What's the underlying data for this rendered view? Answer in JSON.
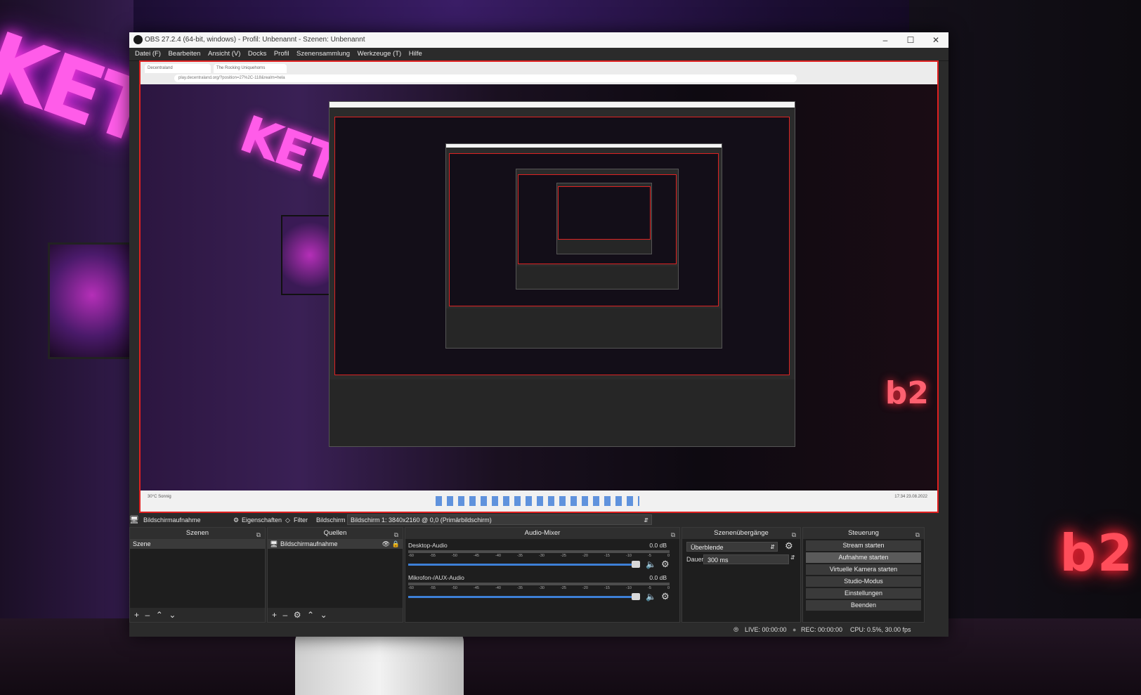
{
  "window": {
    "title": "OBS 27.2.4 (64-bit, windows) - Profil: Unbenannt - Szenen: Unbenannt"
  },
  "menu": [
    "Datei (F)",
    "Bearbeiten",
    "Ansicht (V)",
    "Docks",
    "Profil",
    "Szenensammlung",
    "Werkzeuge (T)",
    "Hilfe"
  ],
  "browser": {
    "tab1": "Decentraland",
    "tab2": "The Rocking Uniquehorns",
    "url": "play.decentraland.org/?position=27%2C-118&realm=hela"
  },
  "taskbar": {
    "weather": "30°C Sonnig",
    "clock": "17:34 23.08.2022"
  },
  "source_toolbar": {
    "source_name": "Bildschirmaufnahme",
    "properties": "Eigenschaften",
    "filter": "Filter",
    "display_label": "Bildschirm",
    "display_value": "Bildschirm 1: 3840x2160 @ 0,0 (Primärbildschirm)"
  },
  "scenes": {
    "title": "Szenen",
    "items": [
      "Szene"
    ]
  },
  "sources": {
    "title": "Quellen",
    "items": [
      "Bildschirmaufnahme"
    ]
  },
  "mixer": {
    "title": "Audio-Mixer",
    "channels": [
      {
        "name": "Desktop-Audio",
        "db": "0.0 dB"
      },
      {
        "name": "Mikrofon-/AUX-Audio",
        "db": "0.0 dB"
      }
    ],
    "ticks": [
      "-60",
      "-55",
      "-50",
      "-45",
      "-40",
      "-35",
      "-30",
      "-25",
      "-20",
      "-15",
      "-10",
      "-5",
      "0"
    ]
  },
  "transitions": {
    "title": "Szenenübergänge",
    "selected": "Überblende",
    "duration_label": "Dauer",
    "duration_value": "300 ms"
  },
  "controls": {
    "title": "Steuerung",
    "buttons": [
      "Stream starten",
      "Aufnahme starten",
      "Virtuelle Kamera starten",
      "Studio-Modus",
      "Einstellungen",
      "Beenden"
    ]
  },
  "status": {
    "live": "LIVE: 00:00:00",
    "rec": "REC: 00:00:00",
    "cpu": "CPU: 0.5%, 30.00 fps"
  },
  "scene_text": {
    "neon": "KET OF",
    "sign": "b2"
  },
  "colors": {
    "accent": "#3d7fd6",
    "preview_border": "#e02020",
    "neon_pink": "#ff5ce9",
    "neon_red": "#ff4d5a"
  }
}
